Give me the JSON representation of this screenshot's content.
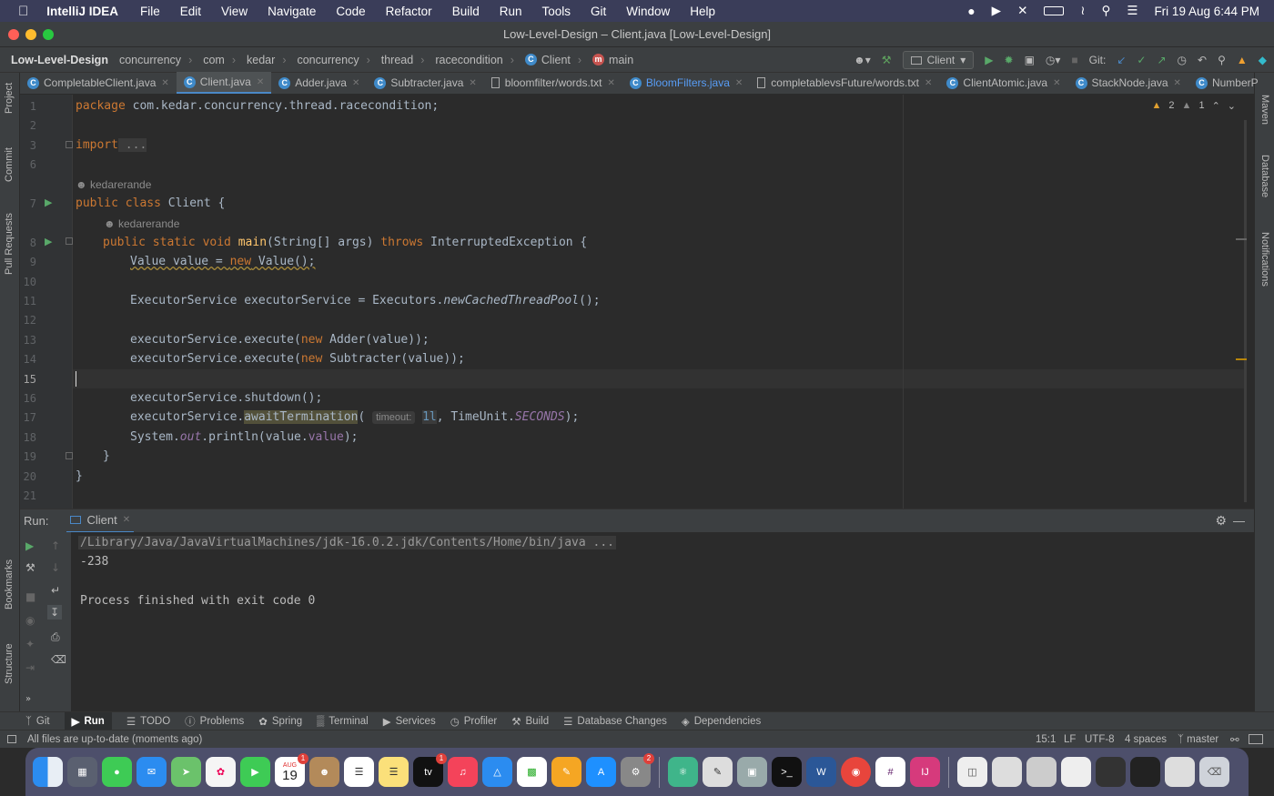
{
  "macmenu": {
    "app": "IntelliJ IDEA",
    "items": [
      "File",
      "Edit",
      "View",
      "Navigate",
      "Code",
      "Refactor",
      "Build",
      "Run",
      "Tools",
      "Git",
      "Window",
      "Help"
    ],
    "clock": "Fri 19 Aug  6:44 PM"
  },
  "window": {
    "title": "Low-Level-Design – Client.java [Low-Level-Design]"
  },
  "breadcrumbs": [
    "Low-Level-Design",
    "concurrency",
    "com",
    "kedar",
    "concurrency",
    "thread",
    "racecondition",
    "Client",
    "main"
  ],
  "toolbar": {
    "run_config": "Client",
    "git_label": "Git:"
  },
  "tabs": [
    {
      "label": "CompletableClient.java",
      "type": "java"
    },
    {
      "label": "Client.java",
      "type": "java",
      "active": true
    },
    {
      "label": "Adder.java",
      "type": "java"
    },
    {
      "label": "Subtracter.java",
      "type": "java"
    },
    {
      "label": "bloomfilter/words.txt",
      "type": "txt"
    },
    {
      "label": "BloomFilters.java",
      "type": "java",
      "highlight": true
    },
    {
      "label": "completablevsFuture/words.txt",
      "type": "txt"
    },
    {
      "label": "ClientAtomic.java",
      "type": "java"
    },
    {
      "label": "StackNode.java",
      "type": "java"
    },
    {
      "label": "NumberP",
      "type": "java"
    }
  ],
  "inspections": {
    "warnings": "2",
    "weak_warnings": "1"
  },
  "side_tools": {
    "left": [
      "Project",
      "Commit",
      "Pull Requests",
      "Bookmarks",
      "Structure"
    ],
    "right": [
      "Maven",
      "Database",
      "Notifications"
    ]
  },
  "editor": {
    "current_line": "15",
    "line_numbers": [
      "1",
      "2",
      "3",
      "6",
      "",
      "7",
      "",
      "8",
      "9",
      "10",
      "11",
      "12",
      "13",
      "14",
      "15",
      "16",
      "17",
      "18",
      "19",
      "20",
      "21"
    ],
    "author": "kedarerande",
    "code": {
      "l1a": "package",
      "l1b": " com.kedar.concurrency.thread.racecondition;",
      "l3a": "import",
      "l3b": " ...",
      "l7a": "public class",
      "l7b": " Client {",
      "l8a": "public static void",
      "l8b": "main",
      "l8c": "(String[] args) ",
      "l8d": "throws",
      "l8e": " InterruptedException {",
      "l9a": "Value value = ",
      "l9b": "new",
      "l9c": " Value();",
      "l11a": "ExecutorService executorService = Executors.",
      "l11b": "newCachedThreadPool",
      "l11c": "();",
      "l13a": "executorService.execute(",
      "l13b": "new",
      "l13c": " Adder(value));",
      "l14a": "executorService.execute(",
      "l14b": "new",
      "l14c": " Subtracter(value));",
      "l16": "executorService.shutdown();",
      "l17a": "executorService.",
      "l17b": "awaitTermination",
      "l17c": "(",
      "l17hint": "timeout:",
      "l17d": "1l",
      ", ": "",
      "l17e": ", TimeUnit.",
      "l17f": "SECONDS",
      "l17g": ");",
      "l18a": "System.",
      "l18b": "out",
      "l18c": ".println(value.",
      "l18d": "value",
      "l18e": ");",
      "l19": "}",
      "l20": "}"
    }
  },
  "run_panel": {
    "label": "Run:",
    "tab": "Client",
    "output": [
      "/Library/Java/JavaVirtualMachines/jdk-16.0.2.jdk/Contents/Home/bin/java ...",
      "-238",
      "",
      "Process finished with exit code 0"
    ]
  },
  "bottom_tools": [
    "Git",
    "Run",
    "TODO",
    "Problems",
    "Spring",
    "Terminal",
    "Services",
    "Profiler",
    "Build",
    "Database Changes",
    "Dependencies"
  ],
  "status": {
    "message": "All files are up-to-date (moments ago)",
    "position": "15:1",
    "line_sep": "LF",
    "encoding": "UTF-8",
    "indent": "4 spaces",
    "branch": "master"
  },
  "dock": {
    "calendar_month": "AUG",
    "calendar_day": "19",
    "badges": {
      "calendar": "1",
      "tv": "1",
      "settings": "2"
    }
  },
  "colors": {
    "accent": "#4a88c7",
    "keyword": "#cc7832",
    "method": "#ffc66d",
    "field": "#9876aa",
    "number": "#6897bb"
  }
}
